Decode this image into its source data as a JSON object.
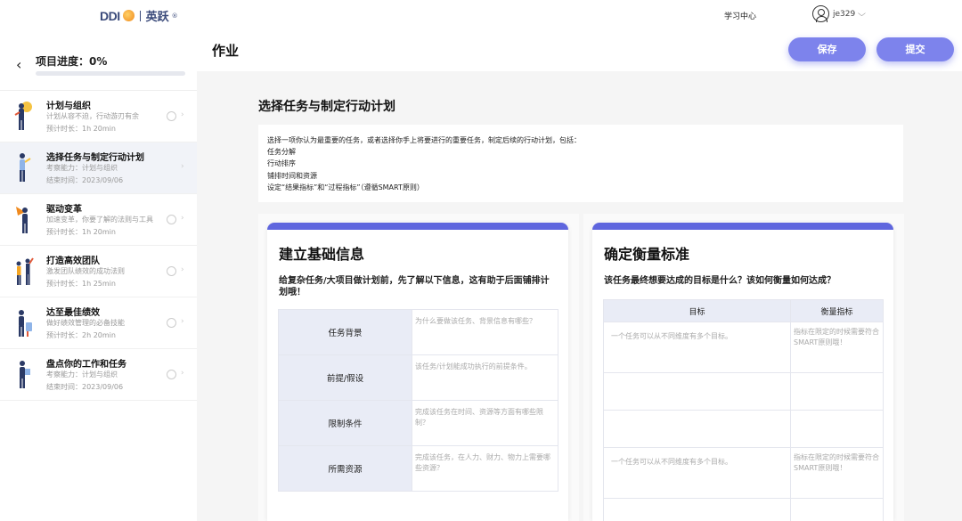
{
  "topbar": {
    "logo_text": "DDI",
    "brand_text": "英跃",
    "registered": "®",
    "learning_center": "学习中心",
    "username": "je329",
    "chevron": "⌵"
  },
  "sidebar": {
    "back_arrow": "‹",
    "progress_label": "项目进度：0%",
    "progress_value": 0,
    "tasks": [
      {
        "title": "计划与组织",
        "line1": "计划从容不迫，行动游刃有余",
        "line2": "预计时长：1h 20min",
        "icon": "figure-planning-icon"
      },
      {
        "title": "选择任务与制定行动计划",
        "line1": "考察能力：计划与组织",
        "line2": "结束时间：2023/09/06",
        "icon": "figure-task-icon"
      },
      {
        "title": "驱动变革",
        "line1": "加速变革，你要了解的法则与工具",
        "line2": "预计时长：1h 20min",
        "icon": "figure-change-icon"
      },
      {
        "title": "打造高效团队",
        "line1": "激发团队绩效的成功法则",
        "line2": "预计时长：1h 25min",
        "icon": "figure-team-icon"
      },
      {
        "title": "达至最佳绩效",
        "line1": "做好绩效管理的必备技能",
        "line2": "预计时长：2h 20min",
        "icon": "figure-performance-icon"
      },
      {
        "title": "盘点你的工作和任务",
        "line1": "考察能力：计划与组织",
        "line2": "结束时间：2023/09/06",
        "icon": "figure-review-icon"
      }
    ]
  },
  "header": {
    "title": "作业",
    "save_label": "保存",
    "submit_label": "提交"
  },
  "main": {
    "section_title": "选择任务与制定行动计划",
    "intro_lines": [
      "选择一项你认为最重要的任务，或者选择你手上将要进行的重要任务，制定后续的行动计划，包括：",
      "任务分解",
      "行动排序",
      "铺排时间和资源",
      "设定“结果指标”和“过程指标”（遵循SMART原则）"
    ],
    "left_card": {
      "title": "建立基础信息",
      "desc": "给复杂任务/大项目做计划前，先了解以下信息，这有助于后面铺排计划哦！",
      "rows": [
        {
          "label": "任务背景",
          "placeholder": "为什么要做该任务、背景信息有哪些？"
        },
        {
          "label": "前提/假设",
          "placeholder": "该任务/计划能成功执行的前提条件。"
        },
        {
          "label": "限制条件",
          "placeholder": "完成该任务在时间、资源等方面有哪些限制？"
        },
        {
          "label": "所需资源",
          "placeholder": "完成该任务，在人力、财力、物力上需要哪些资源？"
        }
      ]
    },
    "right_card": {
      "title": "确定衡量标准",
      "desc": "该任务最终想要达成的目标是什么？该如何衡量如何达成？",
      "col_goal": "目标",
      "col_metric": "衡量指标",
      "goal_placeholder": "一个任务可以从不同维度有多个目标。",
      "metric_placeholder": "指标在限定的时候需要符合SMART原则哦！"
    }
  },
  "colors": {
    "accent": "#5f66de",
    "button": "#7d83ec",
    "table_header": "#e9ecf6"
  }
}
